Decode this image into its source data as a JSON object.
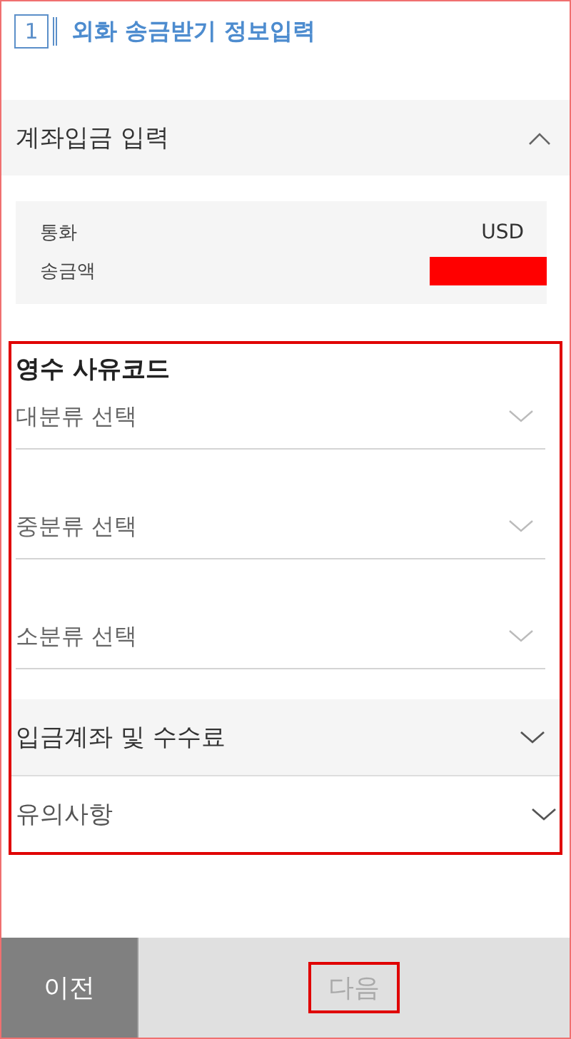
{
  "header": {
    "step": "1",
    "title": "외화 송금받기 정보입력"
  },
  "deposit_section": {
    "title": "계좌입금 입력",
    "expanded": true,
    "fields": [
      {
        "label": "통화",
        "value": "USD",
        "redacted": false
      },
      {
        "label": "송금액",
        "redacted": true
      }
    ]
  },
  "reason_code": {
    "title": "영수 사유코드",
    "highlighted": true,
    "selects": [
      {
        "placeholder": "대분류 선택"
      },
      {
        "placeholder": "중분류 선택"
      },
      {
        "placeholder": "소분류 선택"
      }
    ],
    "accordions": [
      {
        "title": "입금계좌 및 수수료",
        "expanded": false,
        "kind": "shaded"
      },
      {
        "title": "유의사항",
        "expanded": false,
        "kind": "plain"
      }
    ]
  },
  "buttons": [
    {
      "label": "이전",
      "disabled": false,
      "highlighted": false
    },
    {
      "label": "다음",
      "disabled": true,
      "highlighted": true
    }
  ]
}
